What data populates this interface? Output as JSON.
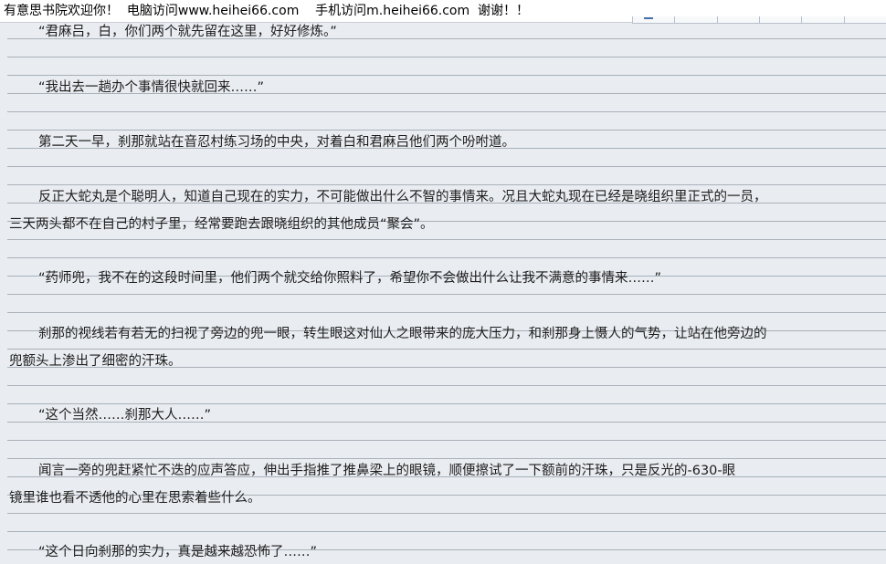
{
  "header": {
    "site_message": "有意思书院欢迎你！  电脑访问www.heihei66.com    手机访问m.heihei66.com  谢谢！！"
  },
  "document": {
    "lines": [
      "“君麻吕，白，你们两个就先留在这里，好好修炼。”",
      "“我出去一趟办个事情很快就回来……”",
      "第二天一早，刹那就站在音忍村练习场的中央，对着白和君麻吕他们两个吩咐道。",
      "反正大蛇丸是个聪明人，知道自己现在的实力，不可能做出什么不智的事情来。况且大蛇丸现在已经是晓组织里正式的一员，",
      "三天两头都不在自己的村子里，经常要跑去跟晓组织的其他成员“聚会”。",
      "“药师兜，我不在的这段时间里，他们两个就交给你照料了，希望你不会做出什么让我不满意的事情来……”",
      "刹那的视线若有若无的扫视了旁边的兜一眼，转生眼这对仙人之眼带来的庞大压力，和刹那身上慑人的气势，让站在他旁边的",
      "兜额头上渗出了细密的汗珠。",
      "“这个当然……刹那大人……”",
      "闻言一旁的兜赶紧忙不迭的应声答应，伸出手指推了推鼻梁上的眼镜，顺便擦试了一下额前的汗珠，只是反光的-630-眼",
      "镜里谁也看不透他的心里在思索着些什么。",
      "“这个日向刹那的实力，真是越来越恐怖了……”"
    ]
  },
  "colors": {
    "background": "#e9ecf0",
    "rule": "#a9b1ba",
    "header_bg": "#ffffff"
  }
}
